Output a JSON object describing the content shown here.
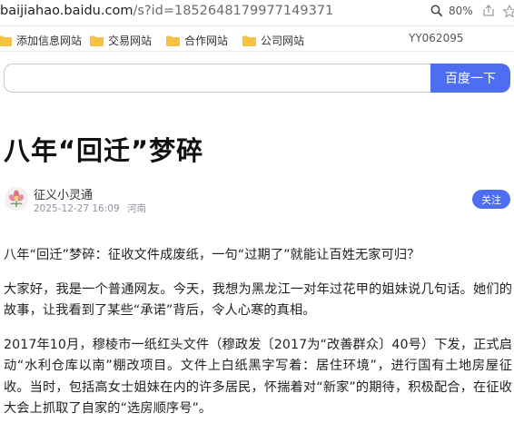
{
  "browser": {
    "url_host": "baijiahao.baidu.com",
    "url_path": "/s?id=1852648179977149371",
    "zoom": "80%"
  },
  "bookmarks": {
    "items": [
      {
        "label": "添加信息网站"
      },
      {
        "label": "交易网站"
      },
      {
        "label": "合作网站"
      },
      {
        "label": "公司网站"
      }
    ],
    "code": "YY062095"
  },
  "search": {
    "query": "",
    "button_label": "百度一下"
  },
  "article": {
    "title": "八年“回迁”梦碎",
    "author": "征义小灵通",
    "date": "2025-12-27 16:09",
    "location": "河南",
    "follow_label": "关注",
    "paragraphs": [
      "八年“回迁”梦碎：征收文件成废纸，一句“过期了”就能让百姓无家可归？",
      "大家好，我是一个普通网友。今天，我想为黑龙江一对年过花甲的姐妹说几句话。她们的故事，让我看到了某些“承诺”背后，令人心寒的真相。",
      "2017年10月，穆棱市一纸红头文件（穆政发〔2017为“改善群众〕40号）下发，正式启动“水利仓库以南”棚改项目。文件上白纸黑字写着：居住环境”，进行国有土地房屋征收。当时，包括高女士姐妹在内的许多居民，怀揣着对“新家”的期待，积极配合，在征收大会上抓取了自家的“选房顺序号”。"
    ]
  },
  "colors": {
    "accent": "#4e6ef2",
    "folder": "#f6c243"
  }
}
